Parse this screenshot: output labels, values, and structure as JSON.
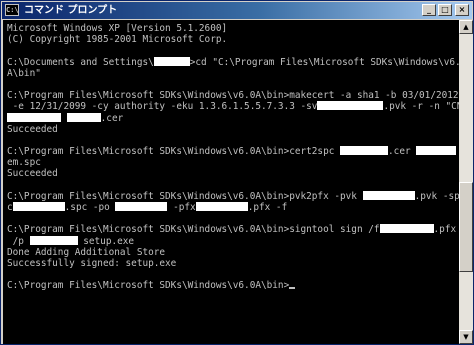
{
  "window": {
    "title": "コマンド プロンプト",
    "system_icon": "C:\\",
    "buttons": {
      "minimize": "_",
      "maximize": "□",
      "close": "×"
    }
  },
  "console": {
    "lines": [
      "Microsoft Windows XP [Version 5.1.2600]",
      "(C) Copyright 1985-2001 Microsoft Corp.",
      "",
      "C:\\Documents and Settings\\",
      "A\\bin\"",
      "",
      "C:\\Program Files\\Microsoft SDKs\\Windows\\v6.0A\\bin>makecert -a sha1 -b 03/01/2012",
      " -e 12/31/2099 -cy authority -eku 1.3.6.1.5.5.7.3.3 -sv",
      "Succeeded",
      "",
      "C:\\Program Files\\Microsoft SDKs\\Windows\\v6.0A\\bin>cert2spc",
      "em.spc",
      "Succeeded",
      "",
      "C:\\Program Files\\Microsoft SDKs\\Windows\\v6.0A\\bin>pvk2pfx -pvk",
      "c",
      "",
      "C:\\Program Files\\Microsoft SDKs\\Windows\\v6.0A\\bin>signtool sign /f",
      " /p",
      "Done Adding Additional Store",
      "Successfully signed: setup.exe",
      "",
      "C:\\Program Files\\Microsoft SDKs\\Windows\\v6.0A\\bin>"
    ],
    "fragments": {
      "cd_cmd": ">cd \"C:\\Program Files\\Microsoft SDKs\\Windows\\v6.0",
      "pvk_ext": ".pvk -r -n \"CN=",
      "cer_ext": ".cer",
      "spc_cer_ext": ".cer",
      "pvk2pfx_pvk_ext": ".pvk -sp",
      "spc_opt": ".spc -po",
      "pfx_opt": "-pfx",
      "pfx_end": ".pfx -f",
      "sign_pfx": ".pfx",
      "setup": " setup.exe"
    }
  },
  "colors": {
    "console_bg": "#000000",
    "console_fg": "#c0c0c0",
    "titlebar_start": "#0a246a",
    "titlebar_end": "#a6caf0",
    "redaction": "#ffffff"
  },
  "scrollbar": {
    "up_arrow": "▲",
    "down_arrow": "▼",
    "thumb_position": 0.72
  }
}
